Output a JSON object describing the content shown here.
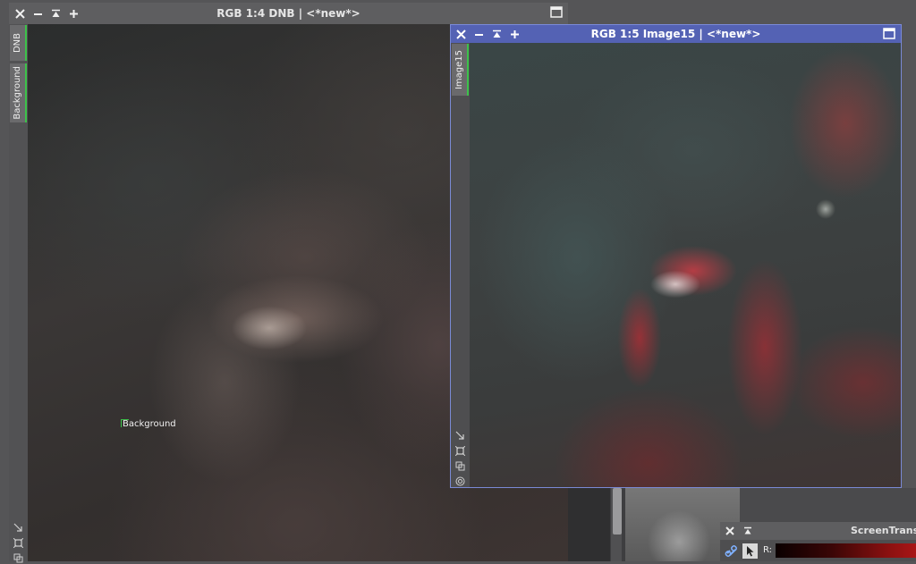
{
  "windows": {
    "dnb": {
      "title": "RGB 1:4 DNB | <*new*>",
      "tabs": [
        "DNB",
        "Background"
      ],
      "preview_label": "Background"
    },
    "image15": {
      "title": "RGB 1:5 Image15 | <*new*>",
      "tabs": [
        "Image15"
      ]
    },
    "screen_transfer": {
      "title": "ScreenTransfe",
      "channel_label": "R:"
    }
  },
  "colors": {
    "active_titlebar": "#5462b4",
    "inactive_titlebar": "#5e5e60",
    "tab_accent": "#3cc24a"
  },
  "icons": [
    "close-icon",
    "minimize-icon",
    "shade-icon",
    "expand-icon",
    "maximize-icon",
    "link-icon",
    "pointer-icon"
  ]
}
